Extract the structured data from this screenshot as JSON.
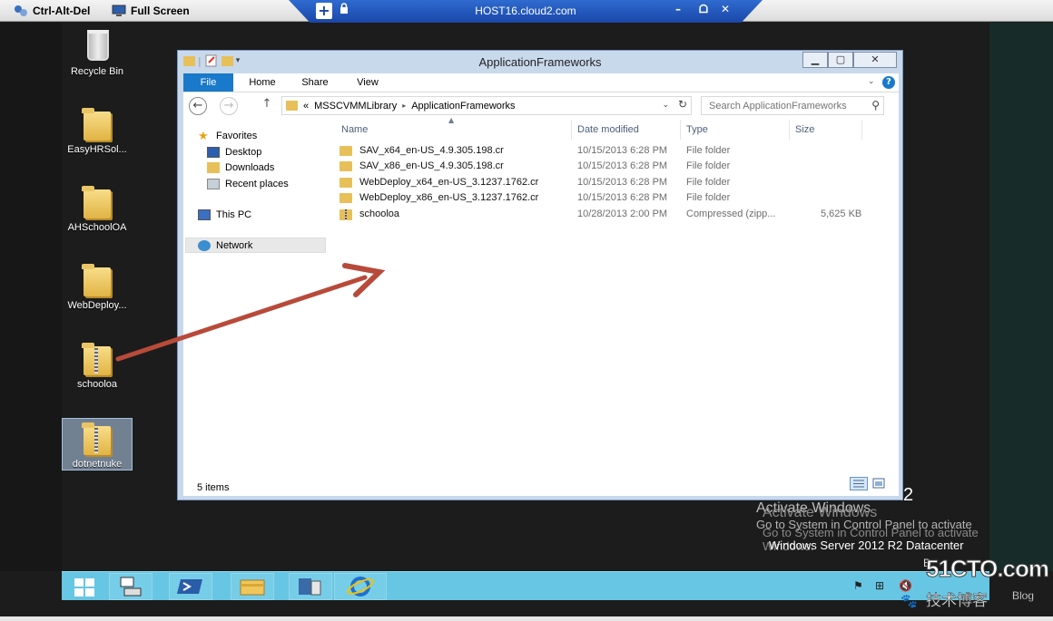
{
  "remote_bar": {
    "ctrl_alt_del": "Ctrl-Alt-Del",
    "full_screen": "Full Screen",
    "host": "HOST16.cloud2.com",
    "minimize": "–",
    "restore": "ᗝ",
    "close": "✕"
  },
  "desktop": {
    "icons": [
      {
        "label": "Recycle Bin"
      },
      {
        "label": "EasyHRSol..."
      },
      {
        "label": "AHSchoolOA"
      },
      {
        "label": "WebDeploy..."
      },
      {
        "label": "schooloa"
      },
      {
        "label": "dotnetnuke"
      }
    ]
  },
  "explorer": {
    "title": "ApplicationFrameworks",
    "tabs": [
      "File",
      "Home",
      "Share",
      "View"
    ],
    "address": {
      "prefix": "«",
      "crumbs": [
        "MSSCVMMLibrary",
        "ApplicationFrameworks"
      ],
      "separator": "▸"
    },
    "search_placeholder": "Search ApplicationFrameworks",
    "nav": {
      "favorites": "Favorites",
      "desktop": "Desktop",
      "downloads": "Downloads",
      "recent": "Recent places",
      "thispc": "This PC",
      "network": "Network"
    },
    "columns": {
      "name": "Name",
      "date": "Date modified",
      "type": "Type",
      "size": "Size"
    },
    "files": [
      {
        "name": "SAV_x64_en-US_4.9.305.198.cr",
        "date": "10/15/2013 6:28 PM",
        "type": "File folder",
        "size": ""
      },
      {
        "name": "SAV_x86_en-US_4.9.305.198.cr",
        "date": "10/15/2013 6:28 PM",
        "type": "File folder",
        "size": ""
      },
      {
        "name": "WebDeploy_x64_en-US_3.1237.1762.cr",
        "date": "10/15/2013 6:28 PM",
        "type": "File folder",
        "size": ""
      },
      {
        "name": "WebDeploy_x86_en-US_3.1237.1762.cr",
        "date": "10/15/2013 6:28 PM",
        "type": "File folder",
        "size": ""
      },
      {
        "name": "schooloa",
        "date": "10/28/2013 2:00 PM",
        "type": "Compressed (zipp...",
        "size": "5,625 KB"
      }
    ],
    "status": "5 items"
  },
  "watermark": {
    "activate_title": "Activate Windows",
    "activate_sub": "Go to System in Control Panel to activate",
    "activate_sub_wrap": "Windows.",
    "os_name": "Windows Server 2012 R2 Datacenter",
    "build_digit": "2",
    "b_letter": "B",
    "site_logo": "51CTO.com",
    "site_sub": "技术博客",
    "site_blog": "Blog"
  },
  "colors": {
    "taskbar": "#67c6e4",
    "file_tab": "#1979ca",
    "arrow": "#b84a3a",
    "host_bar": "#1a47a8"
  }
}
